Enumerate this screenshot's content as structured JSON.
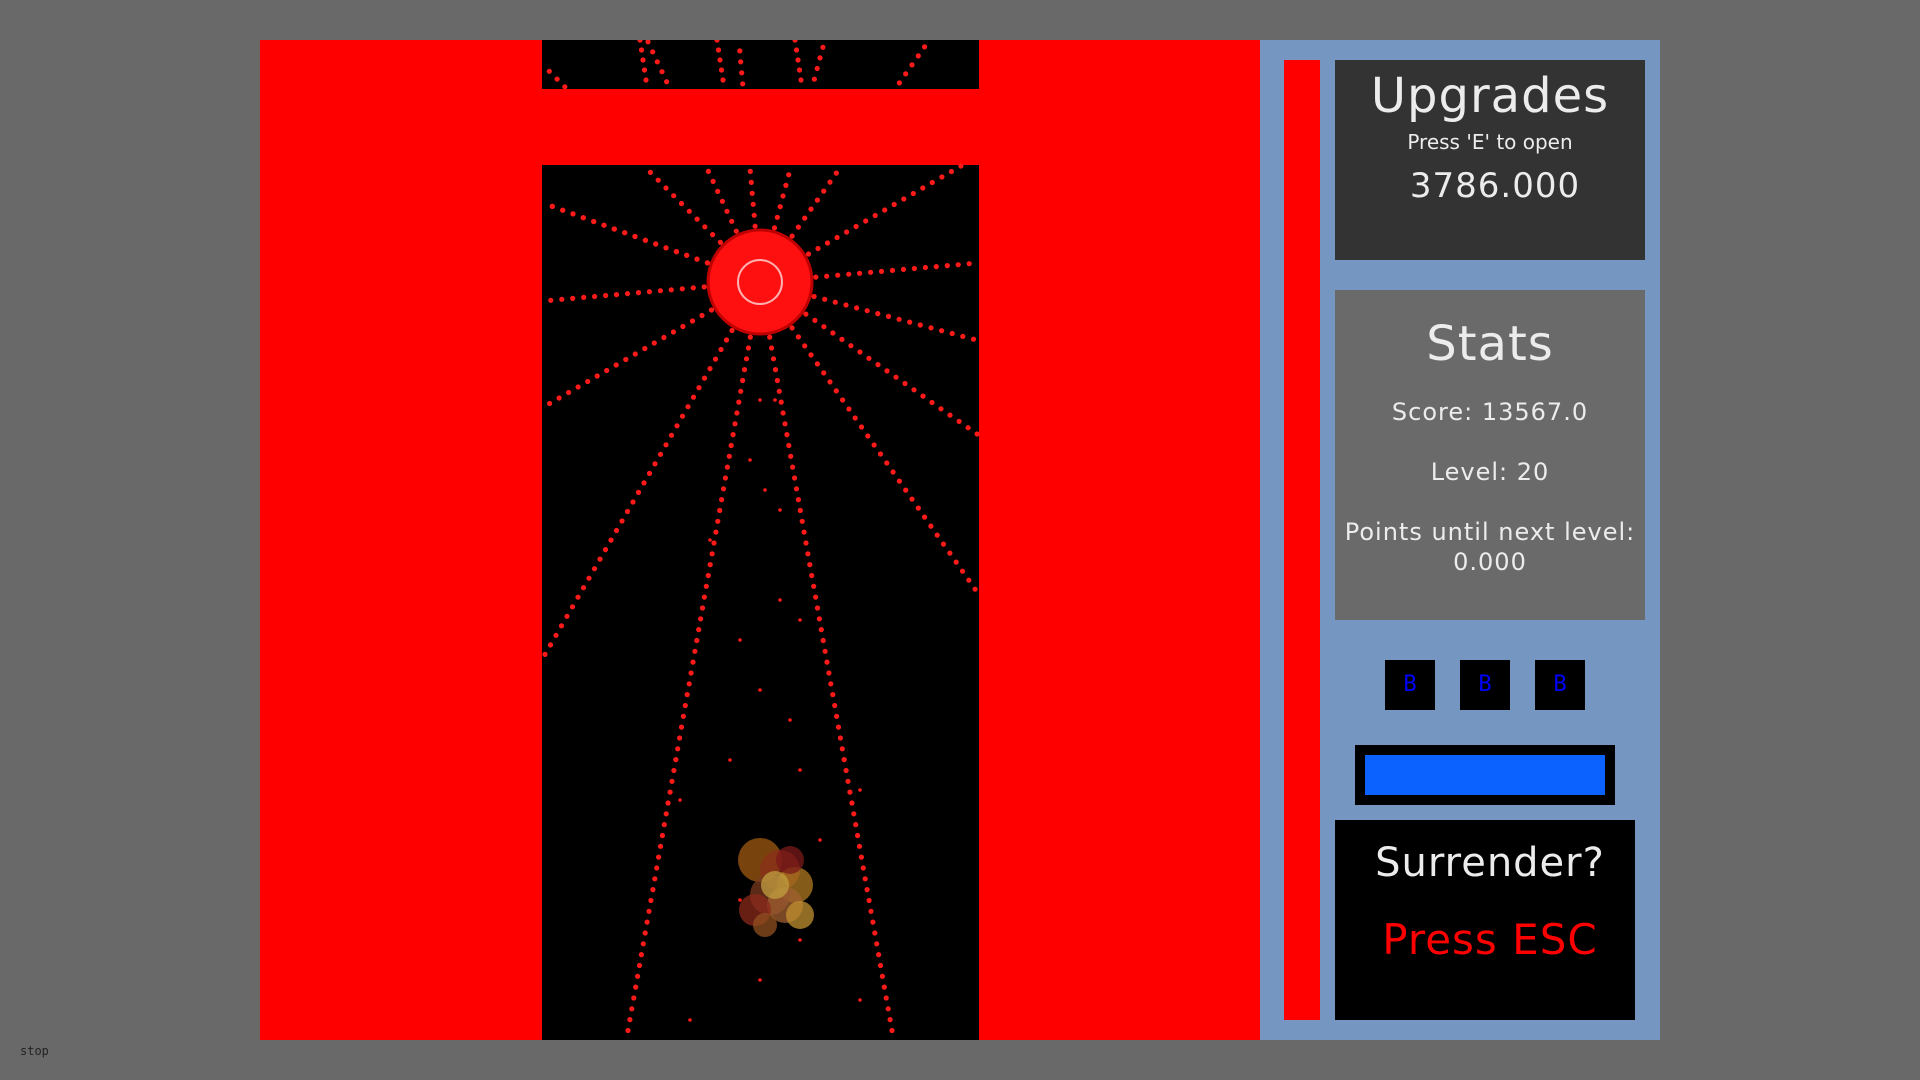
{
  "upgrades": {
    "title": "Upgrades",
    "hint": "Press 'E' to open",
    "money": "3786.000"
  },
  "stats": {
    "title": "Stats",
    "score": "Score: 13567.0",
    "level": "Level: 20",
    "points_label": "Points until next level:",
    "points_value": "0.000"
  },
  "bombs": {
    "count": 3,
    "label": "B"
  },
  "energy": {
    "level": 1.0
  },
  "surrender": {
    "title": "Surrender?",
    "hint": "Press ESC"
  },
  "status": "stop",
  "colors": {
    "background": "#696969",
    "wall": "#ff0000",
    "playfield": "#000000",
    "panel": "#7596c1",
    "upgrades_box": "#333333",
    "stats_box": "#6a6a6a",
    "energy": "#0b62ff",
    "bomb_text": "#0000ff",
    "danger": "#ff0000"
  },
  "icons": {
    "boss": "red-spiked-orb-icon",
    "player": "explosion-cluster-icon",
    "bomb": "bomb-icon"
  }
}
